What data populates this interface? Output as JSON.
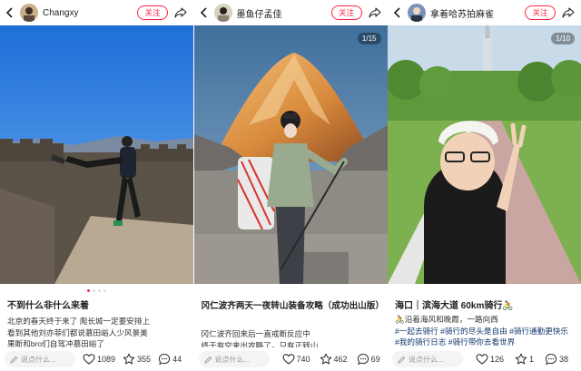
{
  "panels": [
    {
      "username": "Changxy",
      "follow_label": "关注",
      "counter": "",
      "title": "不到什么非什么来着",
      "body_lines": [
        "北京的春天终于来了 爬长城一定要安排上",
        "看到其他刘亦菲们都说慕田峪人少风景美",
        "果断和bro们自驾冲慕田峪了"
      ],
      "comment_placeholder": "说点什么...",
      "likes": "1089",
      "stars": "355",
      "comments": "44"
    },
    {
      "username": "墨鱼仔孟佳",
      "follow_label": "关注",
      "counter": "1/15",
      "title": "冈仁波齐两天一夜转山装备攻略（成功出山版）",
      "body_lines": [
        "冈仁波齐回来后一直戒断反应中",
        "终于有空来出攻略了，只有正转山"
      ],
      "comment_placeholder": "说点什么...",
      "likes": "740",
      "stars": "462",
      "comments": "69"
    },
    {
      "username": "拿着哈苏拍麻雀",
      "follow_label": "关注",
      "counter": "1/10",
      "title": "海口｜滨海大道 60km骑行🚴",
      "body_lines": [
        "🚴沿着海风和晚霞，一路向西"
      ],
      "tags": [
        "#一起去骑行",
        "#骑行的尽头是自由",
        "#骑行通勤更快乐",
        "#我的骑行日志",
        "#骑行带你去看世界"
      ],
      "comment_placeholder": "说点什么...",
      "likes": "126",
      "stars": "1",
      "comments": "38"
    }
  ],
  "colors": {
    "accent": "#ff2442",
    "tag": "#13386c"
  },
  "icons": [
    "back-arrow-icon",
    "share-icon",
    "pencil-icon",
    "heart-icon",
    "star-icon",
    "comment-icon"
  ]
}
